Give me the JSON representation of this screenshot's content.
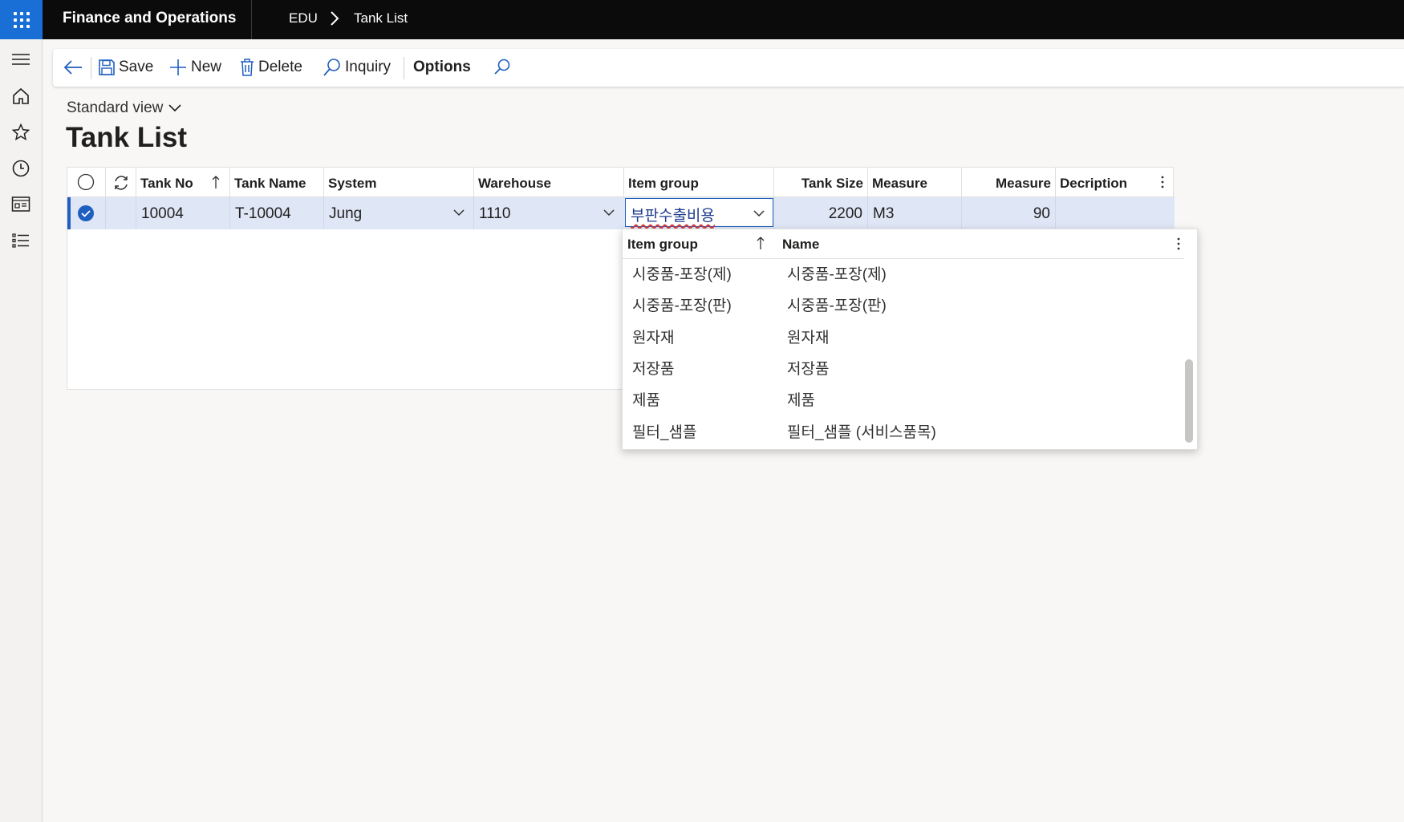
{
  "topbar": {
    "app_title": "Finance and Operations",
    "company": "EDU",
    "page": "Tank List"
  },
  "nav": {
    "items": [
      "hamburger",
      "home",
      "favorites",
      "recent",
      "workspaces",
      "modules"
    ]
  },
  "actions": {
    "save": "Save",
    "new": "New",
    "delete": "Delete",
    "inquiry": "Inquiry",
    "options": "Options"
  },
  "header": {
    "view": "Standard view",
    "title": "Tank List"
  },
  "grid": {
    "columns": {
      "tank_no": "Tank No",
      "tank_name": "Tank Name",
      "system": "System",
      "warehouse": "Warehouse",
      "item_group": "Item group",
      "tank_size": "Tank Size",
      "measure": "Measure",
      "measure2": "Measure",
      "description": "Decription"
    },
    "row": {
      "tank_no": "10004",
      "tank_name": "T-10004",
      "system": "Jung",
      "warehouse": "1110",
      "item_group": "부판수출비용",
      "tank_size": "2200",
      "measure": "M3",
      "measure2": "90",
      "description": ""
    }
  },
  "lookup": {
    "headers": {
      "item_group": "Item group",
      "name": "Name"
    },
    "rows": [
      {
        "item_group": "시중품-포장(제)",
        "name": "시중품-포장(제)"
      },
      {
        "item_group": "시중품-포장(판)",
        "name": "시중품-포장(판)"
      },
      {
        "item_group": "원자재",
        "name": "원자재"
      },
      {
        "item_group": "저장품",
        "name": "저장품"
      },
      {
        "item_group": "제품",
        "name": "제품"
      },
      {
        "item_group": "필터_샘플",
        "name": "필터_샘플 (서비스품목)"
      }
    ]
  },
  "colors": {
    "accent": "#1f5fbf",
    "topbar": "#0b0b0b",
    "waffle": "#1a6fd6",
    "selected_row": "#dfe7f7"
  }
}
